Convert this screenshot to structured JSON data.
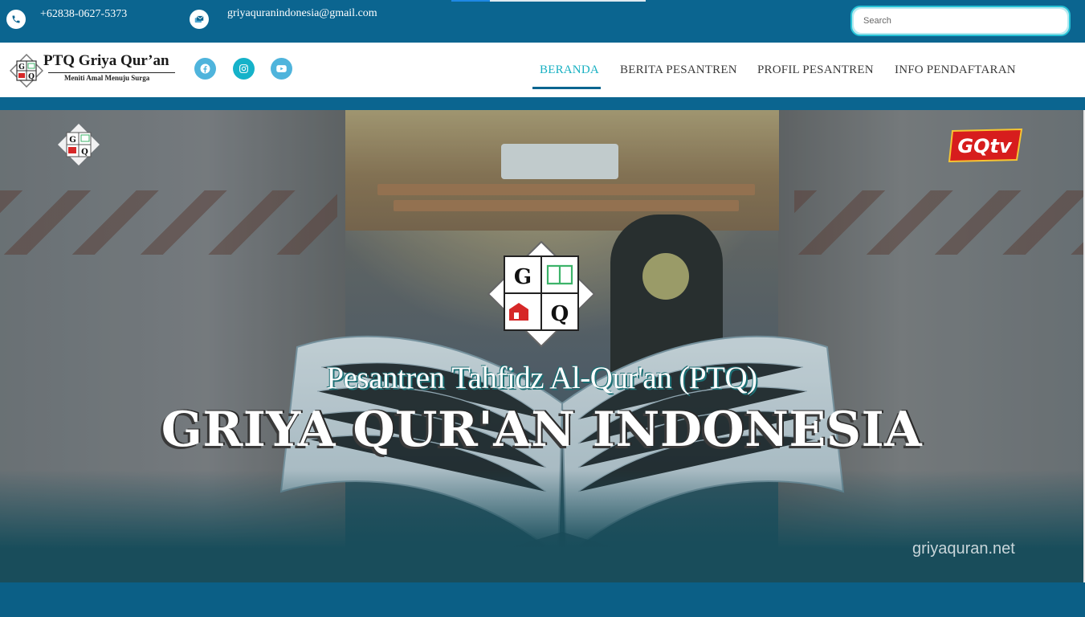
{
  "topbar": {
    "phone": "+62838-0627-5373",
    "email": "griyaquranindonesia@gmail.com",
    "search_placeholder": "Search",
    "icons": {
      "phone": "phone-icon",
      "email": "envelope-icon"
    }
  },
  "brand": {
    "name": "PTQ Griya Qur’an",
    "tagline": "Meniti Amal Menuju Surga",
    "logo_letters": [
      "G",
      "Q"
    ]
  },
  "social": [
    {
      "name": "facebook-icon"
    },
    {
      "name": "instagram-icon"
    },
    {
      "name": "youtube-icon"
    }
  ],
  "nav": {
    "items": [
      {
        "label": "BERANDA",
        "active": true
      },
      {
        "label": "BERITA PESANTREN",
        "active": false
      },
      {
        "label": "PROFIL PESANTREN",
        "active": false
      },
      {
        "label": "INFO PENDAFTARAN",
        "active": false
      }
    ]
  },
  "hero": {
    "subtitle": "Pesantren Tahfidz Al-Qur'an (PTQ)",
    "title": "GRIYA QUR'AN INDONESIA",
    "watermark": "griyaquran.net",
    "badge": "GQtv"
  },
  "colors": {
    "primary": "#0b6590",
    "accent": "#17b0c2",
    "nav_text": "#3b3b3b"
  }
}
